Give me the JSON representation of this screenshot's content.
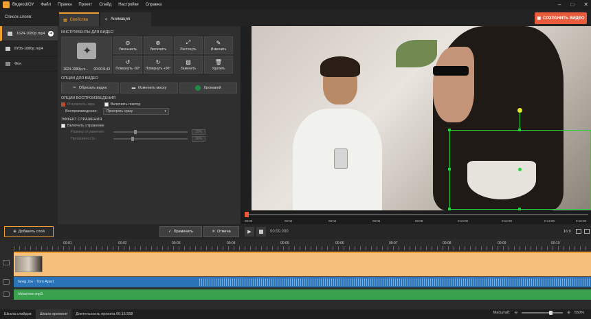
{
  "app": {
    "title": "ВидеоШОУ"
  },
  "menu": [
    "Файл",
    "Правка",
    "Проект",
    "Слайд",
    "Настройки",
    "Справка"
  ],
  "slides_panel": {
    "title": "Список слоев:",
    "items": [
      {
        "label": "1624-1080p.mp4",
        "active": true
      },
      {
        "label": "8705-1080p.mp4",
        "active": false
      },
      {
        "label": "Фон",
        "active": false
      }
    ]
  },
  "tabs": {
    "properties": "Свойства",
    "animation": "Анимация"
  },
  "save_button": "СОХРАНИТЬ ВИДЕО",
  "tools": {
    "header": "ИНСТРУМЕНТЫ ДЛЯ ВИДЕО",
    "thumb_caption": "1624-1080p.m...",
    "thumb_duration": "00:00:8.43",
    "buttons": [
      "Уменьшить",
      "Увеличить",
      "Растянуть",
      "Изменить",
      "Повернуть -90°",
      "Повернуть +90°",
      "Заменить",
      "Удалить"
    ]
  },
  "video_options": {
    "header": "ОПЦИИ ДЛЯ ВИДЕО",
    "crop": "Обрезать видео",
    "mask": "Изменить маску",
    "chroma": "Хромакей"
  },
  "playback": {
    "header": "ОПЦИИ ВОСПРОИЗВЕДЕНИЯ",
    "mute_sound": "Отключить звук",
    "enable_repeat": "Включить повтор",
    "playback_label": "Воспроизведение:",
    "playback_value": "Проиграть сразу"
  },
  "reflection": {
    "header": "ЭФФЕКТ ОТРАЖЕНИЯ",
    "enable": "Включить отражение",
    "size_label": "Размер отражения:",
    "size_value": "20%",
    "opacity_label": "Прозрачность:",
    "opacity_value": "30%"
  },
  "preview_ruler": [
    "00:00",
    "00:02",
    "00:04",
    "00:06",
    "00:08",
    "0:10:00",
    "0:12:00",
    "0:14:00",
    "0:16:00"
  ],
  "midbar": {
    "add_slide": "Добавить слой",
    "apply": "Применить",
    "cancel": "Отмена",
    "time": "00:00.000",
    "ratio": "16:9"
  },
  "timeline_ruler": [
    "00:01",
    "00:02",
    "00:03",
    "00:04",
    "00:05",
    "00:06",
    "00:07",
    "00:08",
    "00:09",
    "00:10"
  ],
  "tracks": {
    "audio1": "Greg Joy - Torn Apart",
    "audio2": "Voiceover.mp3"
  },
  "statusbar": {
    "slides_tab": "Шкала слайдов",
    "timeline_tab": "Шкала времени",
    "duration": "Длительность проекта 00:15.558",
    "zoom_label": "Масштаб:",
    "zoom_value": "550%"
  },
  "colors": {
    "accent": "#f0a030",
    "save": "#e85c3c",
    "selection": "#25d03c",
    "audio1": "#2b73b8",
    "audio2": "#3aa24e"
  }
}
